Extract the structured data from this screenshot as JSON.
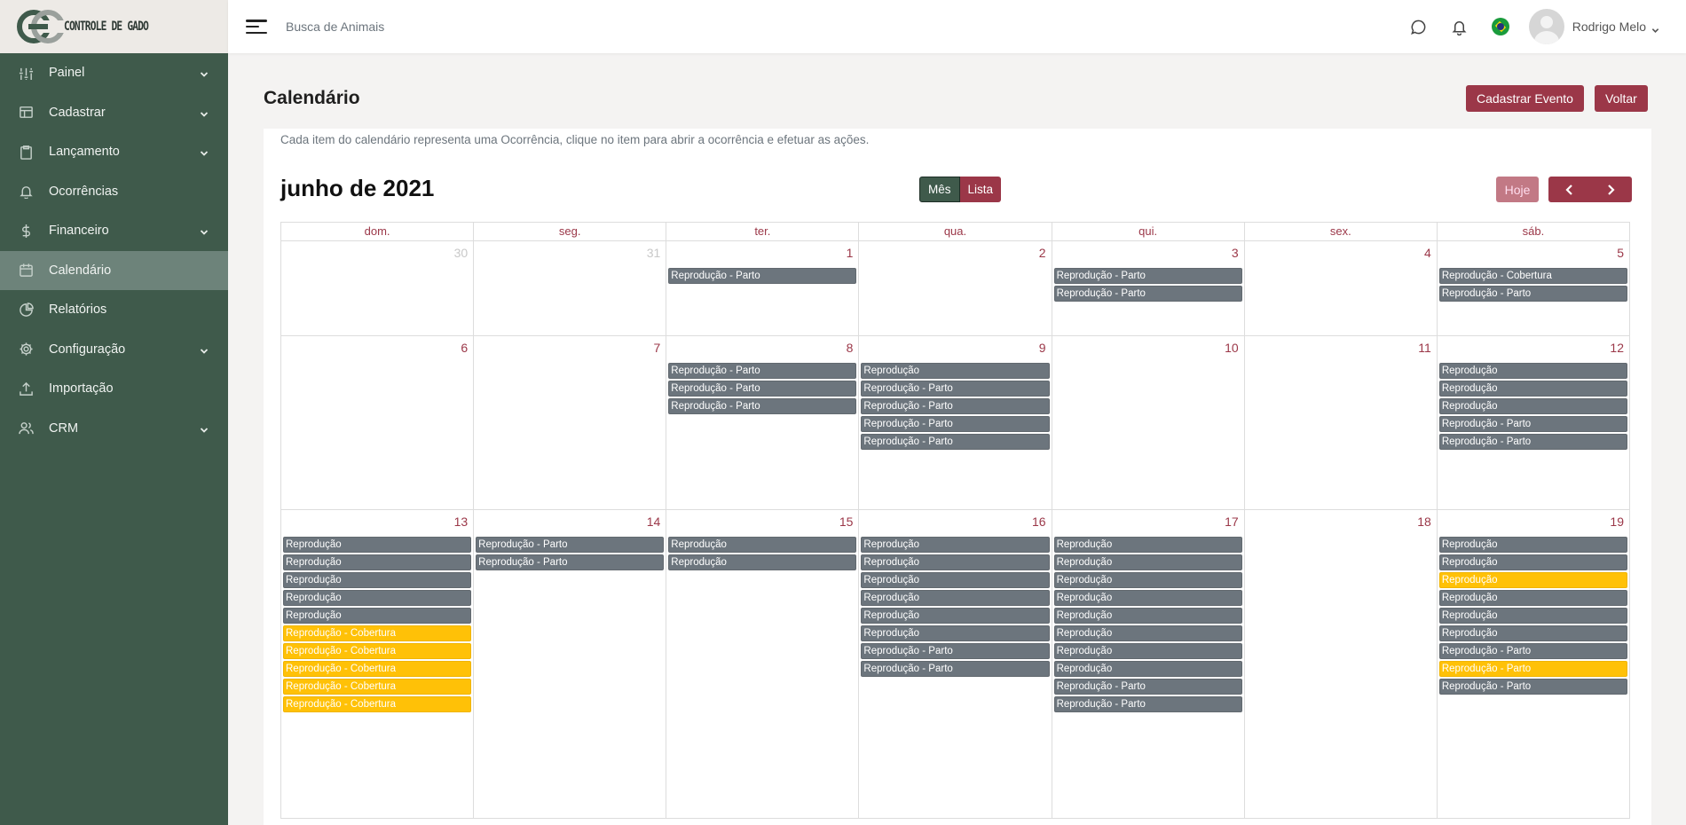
{
  "app": {
    "logo_text": "CONTROLE DE GADO"
  },
  "sidebar": {
    "items": [
      {
        "label": "Painel",
        "icon": "sliders-icon",
        "chevron": true,
        "active": false
      },
      {
        "label": "Cadastrar",
        "icon": "layout-icon",
        "chevron": true,
        "active": false
      },
      {
        "label": "Lançamento",
        "icon": "clipboard-icon",
        "chevron": true,
        "active": false
      },
      {
        "label": "Ocorrências",
        "icon": "bell-icon",
        "chevron": false,
        "active": false
      },
      {
        "label": "Financeiro",
        "icon": "dollar-icon",
        "chevron": true,
        "active": false
      },
      {
        "label": "Calendário",
        "icon": "calendar-icon",
        "chevron": false,
        "active": true
      },
      {
        "label": "Relatórios",
        "icon": "pie-chart-icon",
        "chevron": false,
        "active": false
      },
      {
        "label": "Configuração",
        "icon": "gear-icon",
        "chevron": true,
        "active": false
      },
      {
        "label": "Importação",
        "icon": "upload-icon",
        "chevron": false,
        "active": false
      },
      {
        "label": "CRM",
        "icon": "users-icon",
        "chevron": true,
        "active": false
      }
    ]
  },
  "topbar": {
    "search_label": "Busca de Animais",
    "user_name": "Rodrigo Melo"
  },
  "page": {
    "title": "Calendário",
    "add_event_label": "Cadastrar Evento",
    "back_label": "Voltar",
    "description": "Cada item do calendário representa uma Ocorrência, clique no item para abrir a ocorrência e efetuar as ações."
  },
  "calendar": {
    "month_title": "junho de 2021",
    "view_month_label": "Mês",
    "view_list_label": "Lista",
    "today_label": "Hoje",
    "weekdays": [
      "dom.",
      "seg.",
      "ter.",
      "qua.",
      "qui.",
      "sex.",
      "sáb."
    ],
    "weeks": [
      [
        {
          "day": "30",
          "other": true,
          "events": []
        },
        {
          "day": "31",
          "other": true,
          "events": []
        },
        {
          "day": "1",
          "events": [
            [
              "Reprodução - Parto",
              "gray"
            ]
          ]
        },
        {
          "day": "2",
          "events": []
        },
        {
          "day": "3",
          "events": [
            [
              "Reprodução - Parto",
              "gray"
            ],
            [
              "Reprodução - Parto",
              "gray"
            ]
          ]
        },
        {
          "day": "4",
          "events": []
        },
        {
          "day": "5",
          "events": [
            [
              "Reprodução - Cobertura",
              "gray"
            ],
            [
              "Reprodução - Parto",
              "gray"
            ]
          ]
        }
      ],
      [
        {
          "day": "6",
          "events": []
        },
        {
          "day": "7",
          "events": []
        },
        {
          "day": "8",
          "events": [
            [
              "Reprodução - Parto",
              "gray"
            ],
            [
              "Reprodução - Parto",
              "gray"
            ],
            [
              "Reprodução - Parto",
              "gray"
            ]
          ]
        },
        {
          "day": "9",
          "events": [
            [
              "Reprodução",
              "gray"
            ],
            [
              "Reprodução - Parto",
              "gray"
            ],
            [
              "Reprodução - Parto",
              "gray"
            ],
            [
              "Reprodução - Parto",
              "gray"
            ],
            [
              "Reprodução - Parto",
              "gray"
            ]
          ]
        },
        {
          "day": "10",
          "events": []
        },
        {
          "day": "11",
          "events": []
        },
        {
          "day": "12",
          "events": [
            [
              "Reprodução",
              "gray"
            ],
            [
              "Reprodução",
              "gray"
            ],
            [
              "Reprodução",
              "gray"
            ],
            [
              "Reprodução - Parto",
              "gray"
            ],
            [
              "Reprodução - Parto",
              "gray"
            ]
          ]
        }
      ],
      [
        {
          "day": "13",
          "events": [
            [
              "Reprodução",
              "gray"
            ],
            [
              "Reprodução",
              "gray"
            ],
            [
              "Reprodução",
              "gray"
            ],
            [
              "Reprodução",
              "gray"
            ],
            [
              "Reprodução",
              "gray"
            ],
            [
              "Reprodução - Cobertura",
              "yellow"
            ],
            [
              "Reprodução - Cobertura",
              "yellow"
            ],
            [
              "Reprodução - Cobertura",
              "yellow"
            ],
            [
              "Reprodução - Cobertura",
              "yellow"
            ],
            [
              "Reprodução - Cobertura",
              "yellow"
            ]
          ]
        },
        {
          "day": "14",
          "events": [
            [
              "Reprodução - Parto",
              "gray"
            ],
            [
              "Reprodução - Parto",
              "gray"
            ]
          ]
        },
        {
          "day": "15",
          "events": [
            [
              "Reprodução",
              "gray"
            ],
            [
              "Reprodução",
              "gray"
            ]
          ]
        },
        {
          "day": "16",
          "events": [
            [
              "Reprodução",
              "gray"
            ],
            [
              "Reprodução",
              "gray"
            ],
            [
              "Reprodução",
              "gray"
            ],
            [
              "Reprodução",
              "gray"
            ],
            [
              "Reprodução",
              "gray"
            ],
            [
              "Reprodução",
              "gray"
            ],
            [
              "Reprodução - Parto",
              "gray"
            ],
            [
              "Reprodução - Parto",
              "gray"
            ]
          ]
        },
        {
          "day": "17",
          "events": [
            [
              "Reprodução",
              "gray"
            ],
            [
              "Reprodução",
              "gray"
            ],
            [
              "Reprodução",
              "gray"
            ],
            [
              "Reprodução",
              "gray"
            ],
            [
              "Reprodução",
              "gray"
            ],
            [
              "Reprodução",
              "gray"
            ],
            [
              "Reprodução",
              "gray"
            ],
            [
              "Reprodução",
              "gray"
            ],
            [
              "Reprodução - Parto",
              "gray"
            ],
            [
              "Reprodução - Parto",
              "gray"
            ]
          ]
        },
        {
          "day": "18",
          "events": []
        },
        {
          "day": "19",
          "events": [
            [
              "Reprodução",
              "gray"
            ],
            [
              "Reprodução",
              "gray"
            ],
            [
              "Reprodução",
              "yellow"
            ],
            [
              "Reprodução",
              "gray"
            ],
            [
              "Reprodução",
              "gray"
            ],
            [
              "Reprodução",
              "gray"
            ],
            [
              "Reprodução - Parto",
              "gray"
            ],
            [
              "Reprodução - Parto",
              "yellow"
            ],
            [
              "Reprodução - Parto",
              "gray"
            ]
          ]
        }
      ]
    ]
  },
  "colors": {
    "sidebar": "#3f5a4b",
    "accent": "#9b3748",
    "event_gray": "#6c757d",
    "event_yellow": "#ffc107"
  }
}
